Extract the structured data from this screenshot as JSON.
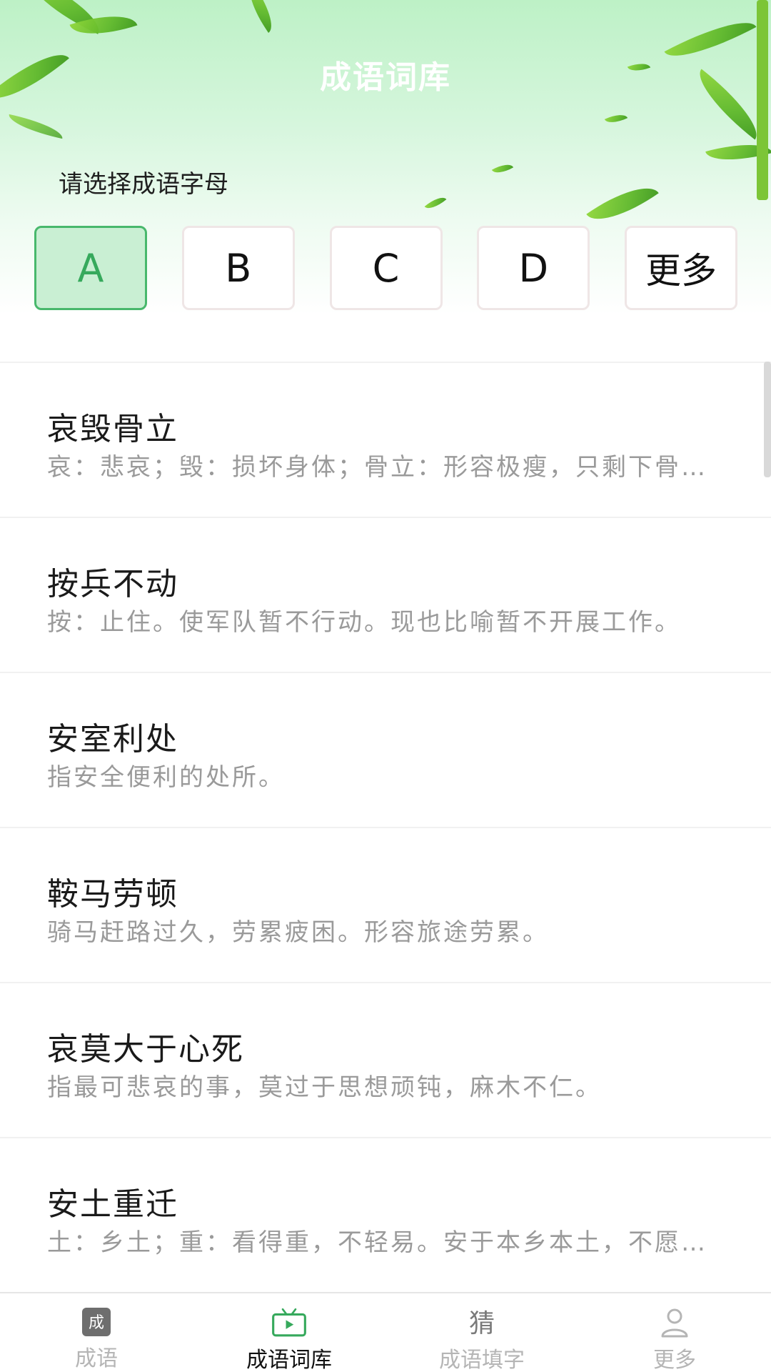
{
  "header": {
    "title": "成语词库",
    "prompt": "请选择成语字母"
  },
  "letters": [
    {
      "label": "A",
      "selected": true
    },
    {
      "label": "B",
      "selected": false
    },
    {
      "label": "C",
      "selected": false
    },
    {
      "label": "D",
      "selected": false
    },
    {
      "label": "更多",
      "selected": false
    }
  ],
  "idioms": [
    {
      "word": "哀毁骨立",
      "desc": "哀：悲哀；毁：损坏身体；骨立：形容极瘦，只剩下骨架。"
    },
    {
      "word": "按兵不动",
      "desc": "按：止住。使军队暂不行动。现也比喻暂不开展工作。"
    },
    {
      "word": "安室利处",
      "desc": "指安全便利的处所。"
    },
    {
      "word": "鞍马劳顿",
      "desc": "骑马赶路过久，劳累疲困。形容旅途劳累。"
    },
    {
      "word": "哀莫大于心死",
      "desc": "指最可悲哀的事，莫过于思想顽钝，麻木不仁。"
    },
    {
      "word": "安土重迁",
      "desc": "土：乡土；重：看得重，不轻易。安于本乡本土，不愿轻易迁移。"
    }
  ],
  "tabs": [
    {
      "label": "成语",
      "icon": "idiom-icon",
      "icon_text": "成",
      "active": false
    },
    {
      "label": "成语词库",
      "icon": "tv-icon",
      "active": true
    },
    {
      "label": "成语填字",
      "icon": "guess-icon",
      "icon_text": "猜",
      "active": false
    },
    {
      "label": "更多",
      "icon": "person-icon",
      "active": false
    }
  ],
  "colors": {
    "accent": "#36a95c",
    "selected_bg": "#c9efd3",
    "desc_text": "#9a9a9a",
    "tab_inactive": "#b5b5b5"
  }
}
